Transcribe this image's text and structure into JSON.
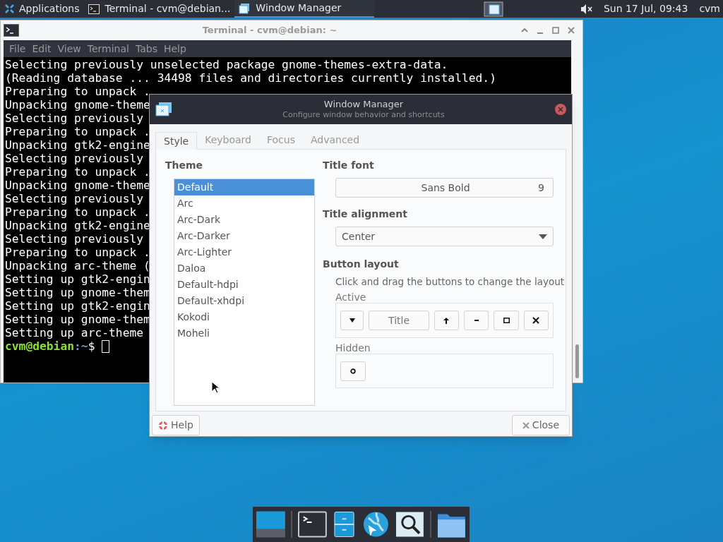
{
  "top_panel": {
    "applications": "Applications",
    "tasks": [
      {
        "label": "Terminal - cvm@debian...",
        "kind": "terminal",
        "selected": false
      },
      {
        "label": "Window Manager",
        "kind": "settings",
        "selected": true
      }
    ],
    "clock": "Sun 17 Jul, 09:43",
    "user": "cvm"
  },
  "terminal": {
    "title": "Terminal - cvm@debian: ~",
    "menu": [
      "File",
      "Edit",
      "View",
      "Terminal",
      "Tabs",
      "Help"
    ],
    "lines": [
      "Selecting previously unselected package gnome-themes-extra-data.",
      "(Reading database ... 34498 files and directories currently installed.)",
      "Preparing to unpack .",
      "Unpacking gnome-theme",
      "Selecting previously",
      "Preparing to unpack .",
      "Unpacking gtk2-engine",
      "Selecting previously",
      "Preparing to unpack .",
      "Unpacking gnome-theme",
      "Selecting previously",
      "Preparing to unpack .",
      "Unpacking gtk2-engine",
      "Selecting previously",
      "Preparing to unpack .",
      "Unpacking arc-theme (",
      "Setting up gtk2-engin",
      "Setting up gnome-them",
      "Setting up gtk2-engin",
      "Setting up gnome-them",
      "Setting up arc-theme "
    ],
    "prompt_user": "cvm@debian",
    "prompt_path": ":~",
    "prompt_sign": "$"
  },
  "dialog": {
    "title": "Window Manager",
    "subtitle": "Configure window behavior and shortcuts",
    "tabs": [
      {
        "label": "Style",
        "selected": true
      },
      {
        "label": "Keyboard",
        "selected": false
      },
      {
        "label": "Focus",
        "selected": false
      },
      {
        "label": "Advanced",
        "selected": false
      }
    ],
    "theme_label": "Theme",
    "themes": [
      {
        "label": "Default",
        "selected": true
      },
      {
        "label": "Arc",
        "selected": false
      },
      {
        "label": "Arc-Dark",
        "selected": false
      },
      {
        "label": "Arc-Darker",
        "selected": false
      },
      {
        "label": "Arc-Lighter",
        "selected": false
      },
      {
        "label": "Daloa",
        "selected": false
      },
      {
        "label": "Default-hdpi",
        "selected": false
      },
      {
        "label": "Default-xhdpi",
        "selected": false
      },
      {
        "label": "Kokodi",
        "selected": false
      },
      {
        "label": "Moheli",
        "selected": false
      }
    ],
    "title_font_label": "Title font",
    "title_font": "Sans Bold",
    "title_font_size": "9",
    "title_alignment_label": "Title alignment",
    "title_alignment": "Center",
    "button_layout_label": "Button layout",
    "button_layout_hint": "Click and drag the buttons to change the layout",
    "active_label": "Active",
    "active_buttons": [
      {
        "kind": "menu"
      },
      {
        "kind": "title",
        "label": "Title"
      },
      {
        "kind": "shade"
      },
      {
        "kind": "minimize"
      },
      {
        "kind": "maximize"
      },
      {
        "kind": "close"
      }
    ],
    "hidden_label": "Hidden",
    "hidden_buttons": [
      {
        "kind": "stick"
      }
    ],
    "help": "Help",
    "close": "Close"
  }
}
